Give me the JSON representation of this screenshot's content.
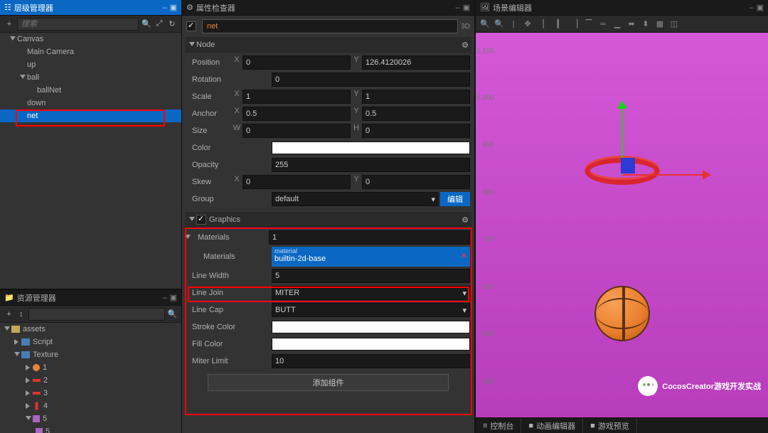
{
  "hierarchy": {
    "title": "层级管理器",
    "search_placeholder": "搜索",
    "tree": {
      "canvas": "Canvas",
      "camera": "Main Camera",
      "up": "up",
      "ball": "ball",
      "ballNet": "ballNet",
      "down": "down",
      "net": "net"
    }
  },
  "assets": {
    "title": "资源管理器",
    "root": "assets",
    "script": "Script",
    "texture": "Texture",
    "items": {
      "i1": "1",
      "i2": "2",
      "i3": "3",
      "i4": "4",
      "i5a": "5",
      "i5b": "5"
    }
  },
  "inspector": {
    "title": "属性检查器",
    "node_name": "net",
    "badge": "3D",
    "node_section": "Node",
    "props": {
      "position": {
        "label": "Position",
        "x": "0",
        "y": "126.4120026"
      },
      "rotation": {
        "label": "Rotation",
        "v": "0"
      },
      "scale": {
        "label": "Scale",
        "x": "1",
        "y": "1"
      },
      "anchor": {
        "label": "Anchor",
        "x": "0.5",
        "y": "0.5"
      },
      "size": {
        "label": "Size",
        "w": "0",
        "h": "0"
      },
      "color": {
        "label": "Color"
      },
      "opacity": {
        "label": "Opacity",
        "v": "255"
      },
      "skew": {
        "label": "Skew",
        "x": "0",
        "y": "0"
      },
      "group": {
        "label": "Group",
        "v": "default",
        "btn": "编辑"
      }
    },
    "graphics": {
      "title": "Graphics",
      "materials": {
        "label": "Materials",
        "count": "1",
        "hint": "material",
        "value": "builtin-2d-base"
      },
      "materials_sub": {
        "label": "Materials"
      },
      "line_width": {
        "label": "Line Width",
        "v": "5"
      },
      "line_join": {
        "label": "Line Join",
        "v": "MITER"
      },
      "line_cap": {
        "label": "Line Cap",
        "v": "BUTT"
      },
      "stroke_color": {
        "label": "Stroke Color"
      },
      "fill_color": {
        "label": "Fill Color"
      },
      "miter_limit": {
        "label": "Miter Limit",
        "v": "10"
      }
    },
    "add_component": "添加组件"
  },
  "scene": {
    "title": "场景编辑器",
    "ruler": {
      "r1100": "1,100",
      "r1000": "1,000",
      "r900": "900",
      "r800": "800",
      "r700": "700",
      "r600": "600",
      "r500": "500",
      "r400": "400"
    }
  },
  "bottom": {
    "console": "控制台",
    "animation": "动画编辑器",
    "preview": "游戏预览"
  },
  "watermark": "CocosCreator游戏开发实战"
}
